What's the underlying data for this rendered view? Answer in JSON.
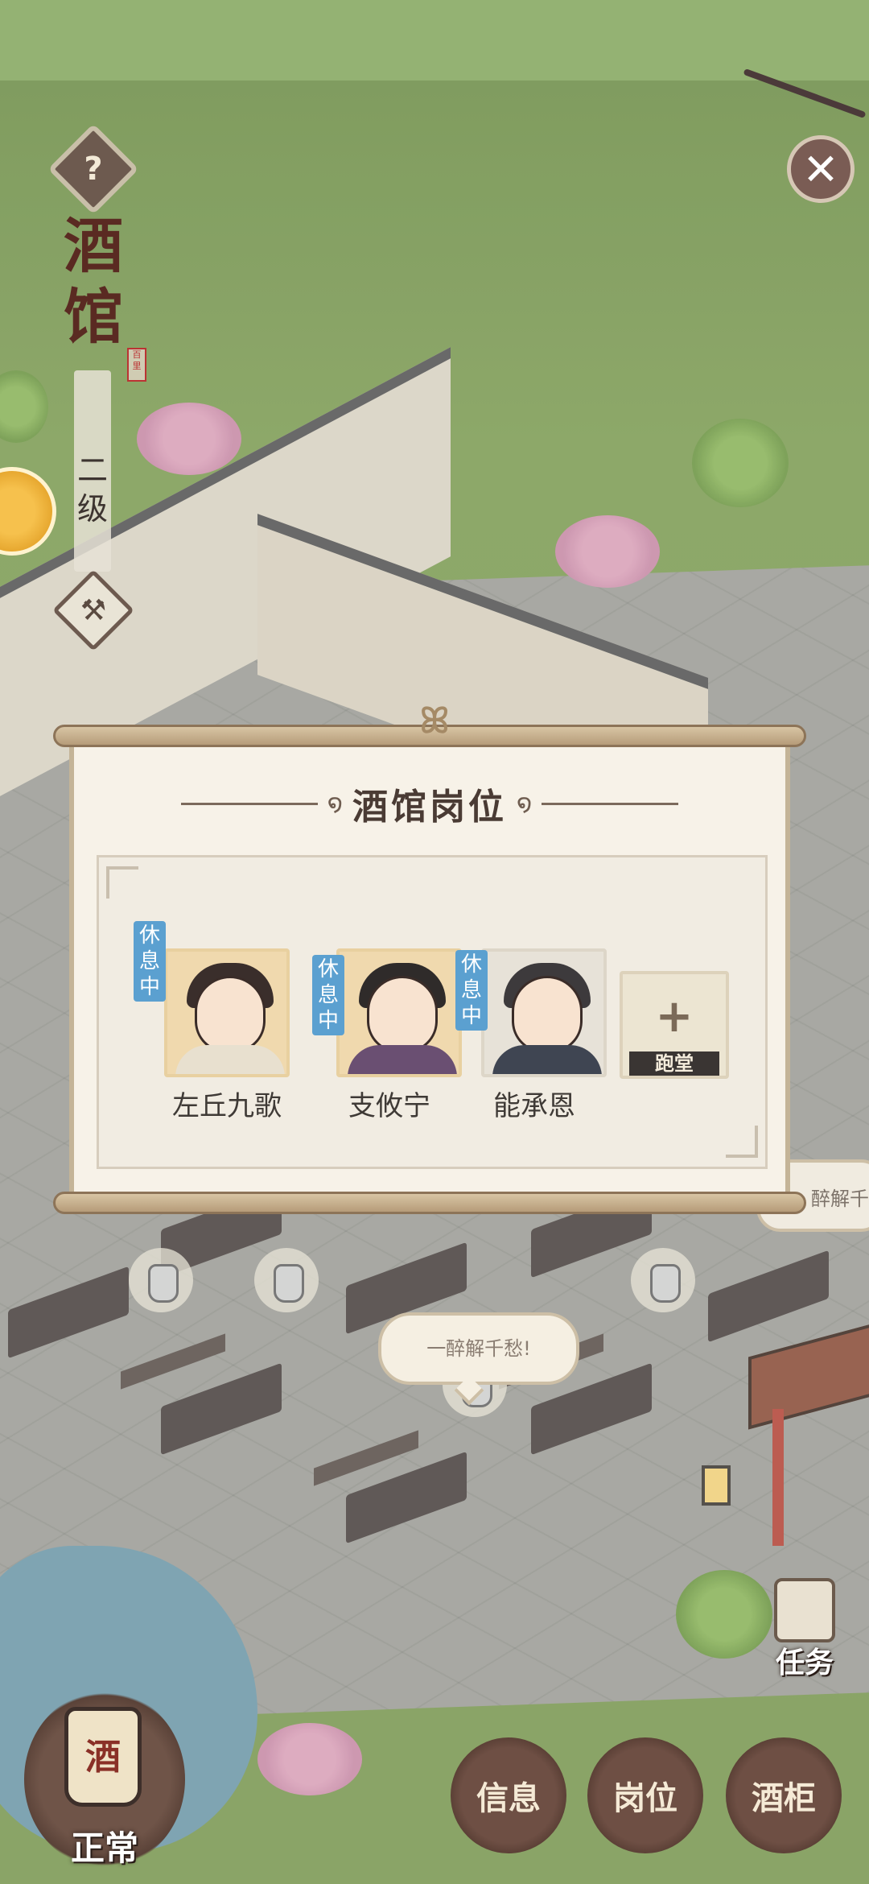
{
  "header": {
    "help_icon": "?",
    "shop_title": "酒馆",
    "shop_seal": "百里",
    "level": "二级",
    "build_icon": "hammer",
    "close_icon": "✕"
  },
  "modal": {
    "title": "酒馆岗位",
    "staff": [
      {
        "name": "左丘九歌",
        "status": "休息中"
      },
      {
        "name": "支攸宁",
        "status": "休息中"
      },
      {
        "name": "能承恩",
        "status": "休息中"
      }
    ],
    "add_slot": {
      "plus": "+",
      "label": "跑堂"
    }
  },
  "world": {
    "speech": "一醉解千愁!",
    "speech_right": "醉解千"
  },
  "bottom": {
    "status_jar": "酒",
    "status_label": "正常",
    "task_label": "任务",
    "buttons": {
      "info": "信息",
      "positions": "岗位",
      "cabinet": "酒柜"
    }
  }
}
